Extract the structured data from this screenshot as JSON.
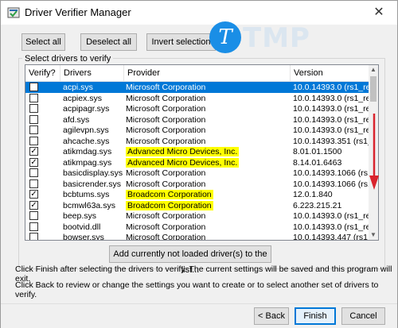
{
  "window": {
    "title": "Driver Verifier Manager",
    "close_glyph": "✕"
  },
  "toolbar": {
    "select_all": "Select all",
    "deselect_all": "Deselect all",
    "invert_selection": "Invert selection"
  },
  "group_label": "Select drivers to verify",
  "columns": [
    "Verify?",
    "Drivers",
    "Provider",
    "Version"
  ],
  "rows": [
    {
      "checked": false,
      "driver": "acpi.sys",
      "provider": "Microsoft Corporation",
      "version": "10.0.14393.0 (rs1_rel...",
      "selected": true,
      "highlight": false
    },
    {
      "checked": false,
      "driver": "acpiex.sys",
      "provider": "Microsoft Corporation",
      "version": "10.0.14393.0 (rs1_rel...",
      "selected": false,
      "highlight": false
    },
    {
      "checked": false,
      "driver": "acpipagr.sys",
      "provider": "Microsoft Corporation",
      "version": "10.0.14393.0 (rs1_rel...",
      "selected": false,
      "highlight": false
    },
    {
      "checked": false,
      "driver": "afd.sys",
      "provider": "Microsoft Corporation",
      "version": "10.0.14393.0 (rs1_rel...",
      "selected": false,
      "highlight": false
    },
    {
      "checked": false,
      "driver": "agilevpn.sys",
      "provider": "Microsoft Corporation",
      "version": "10.0.14393.0 (rs1_rel...",
      "selected": false,
      "highlight": false
    },
    {
      "checked": false,
      "driver": "ahcache.sys",
      "provider": "Microsoft Corporation",
      "version": "10.0.14393.351 (rs1_re...",
      "selected": false,
      "highlight": false
    },
    {
      "checked": true,
      "driver": "atikmdag.sys",
      "provider": "Advanced Micro Devices, Inc.",
      "version": "8.01.01.1500",
      "selected": false,
      "highlight": true
    },
    {
      "checked": true,
      "driver": "atikmpag.sys",
      "provider": "Advanced Micro Devices, Inc.",
      "version": "8.14.01.6463",
      "selected": false,
      "highlight": true
    },
    {
      "checked": false,
      "driver": "basicdisplay.sys",
      "provider": "Microsoft Corporation",
      "version": "10.0.14393.1066 (rs1...",
      "selected": false,
      "highlight": false
    },
    {
      "checked": false,
      "driver": "basicrender.sys",
      "provider": "Microsoft Corporation",
      "version": "10.0.14393.1066 (rs1...",
      "selected": false,
      "highlight": false
    },
    {
      "checked": true,
      "driver": "bcbtums.sys",
      "provider": "Broadcom Corporation",
      "version": "12.0.1.840",
      "selected": false,
      "highlight": true
    },
    {
      "checked": true,
      "driver": "bcmwl63a.sys",
      "provider": "Broadcom Corporation",
      "version": "6.223.215.21",
      "selected": false,
      "highlight": true
    },
    {
      "checked": false,
      "driver": "beep.sys",
      "provider": "Microsoft Corporation",
      "version": "10.0.14393.0 (rs1_rel...",
      "selected": false,
      "highlight": false
    },
    {
      "checked": false,
      "driver": "bootvid.dll",
      "provider": "Microsoft Corporation",
      "version": "10.0.14393.0 (rs1_rel...",
      "selected": false,
      "highlight": false
    },
    {
      "checked": false,
      "driver": "bowser.sys",
      "provider": "Microsoft Corporation",
      "version": "10.0.14393.447 (rs1_rel...",
      "selected": false,
      "highlight": false
    }
  ],
  "add_button": "Add currently not loaded driver(s) to the list...",
  "info": {
    "line1": "Click Finish after selecting the drivers to verify. The current settings will be saved and this program will exit.",
    "line2": "Click Back to review or change the settings you want to create or to select another set of drivers to verify."
  },
  "footer": {
    "back": "< Back",
    "finish": "Finish",
    "cancel": "Cancel"
  },
  "watermark": {
    "letter": "T",
    "text": "TMP"
  },
  "colors": {
    "selection": "#0078d7",
    "highlight": "#ffff00",
    "arrow": "#d9232d",
    "logo": "#1a8ee6"
  },
  "icons": {
    "app": "driver-verifier-icon",
    "close": "close-icon",
    "check": "checkmark-icon",
    "scroll_up": "scroll-up-icon",
    "scroll_down": "scroll-down-icon"
  }
}
